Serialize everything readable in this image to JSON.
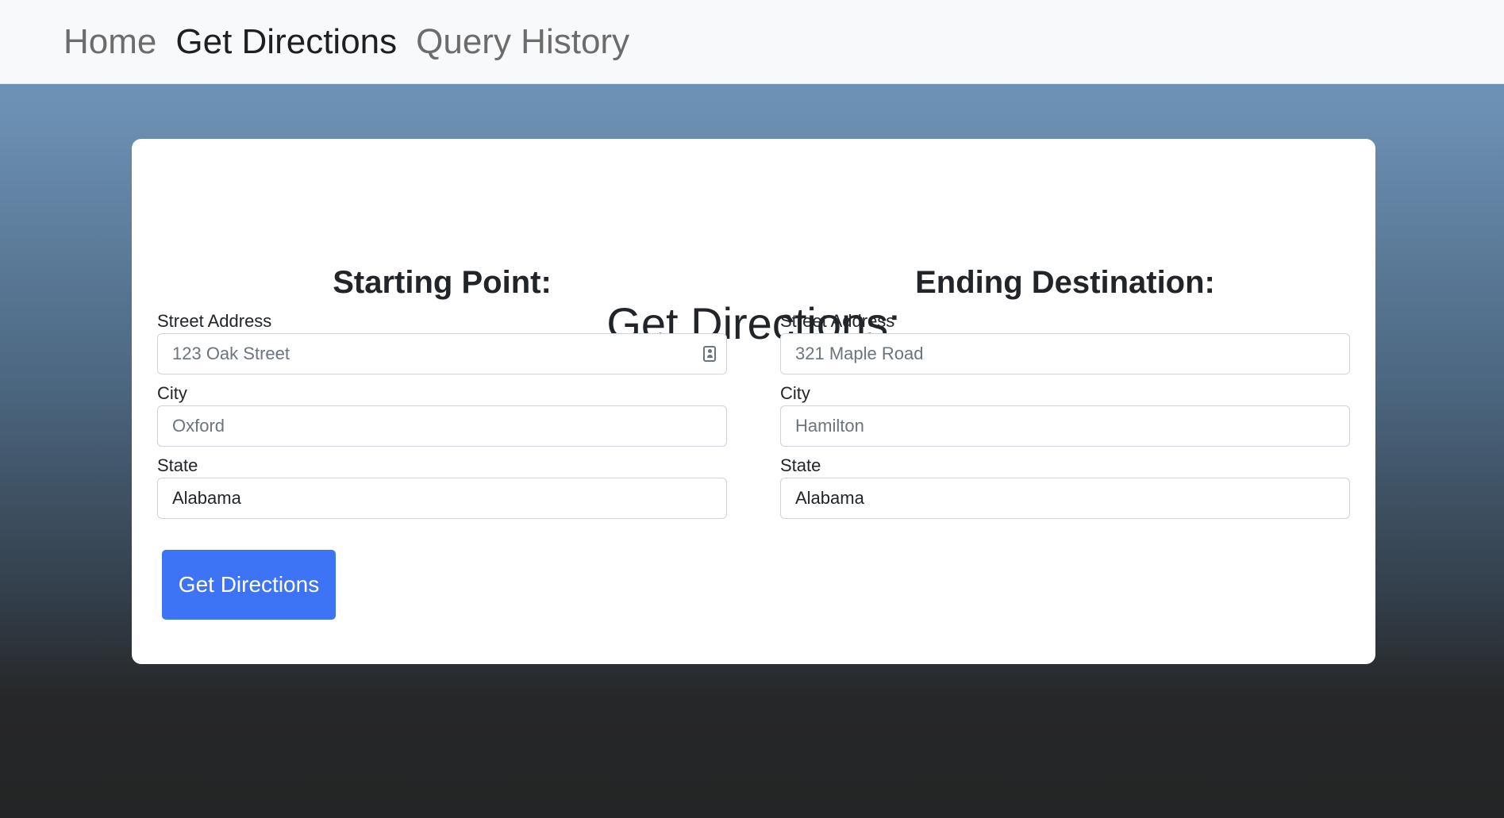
{
  "nav": {
    "items": [
      {
        "label": "Home",
        "active": false
      },
      {
        "label": "Get Directions",
        "active": true
      },
      {
        "label": "Query History",
        "active": false
      }
    ]
  },
  "form": {
    "title": "Get Directions:",
    "start": {
      "heading": "Starting Point:",
      "street_label": "Street Address",
      "street_placeholder": "123 Oak Street",
      "city_label": "City",
      "city_placeholder": "Oxford",
      "state_label": "State",
      "state_value": "Alabama"
    },
    "end": {
      "heading": "Ending Destination:",
      "street_label": "Street Address",
      "street_placeholder": "321 Maple Road",
      "city_label": "City",
      "city_placeholder": "Hamilton",
      "state_label": "State",
      "state_value": "Alabama"
    },
    "submit_label": "Get Directions"
  },
  "colors": {
    "primary_button": "#3d74f5",
    "navbar_bg": "#f8f9fa",
    "gradient_top": "#7199bd",
    "gradient_bottom": "#242526"
  },
  "icons": {
    "street_autofill": "contact-card-icon"
  }
}
